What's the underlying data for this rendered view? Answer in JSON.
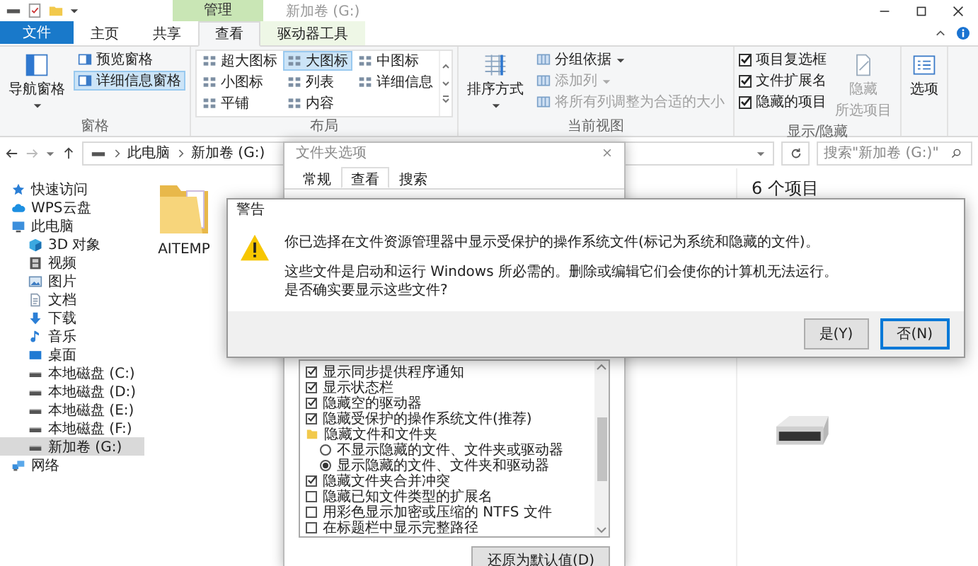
{
  "title_bar": {
    "context_tab": "管理",
    "title": "新加卷 (G:)"
  },
  "ribbon_tabs": [
    {
      "label": "文件",
      "kind": "file",
      "selected": false
    },
    {
      "label": "主页",
      "kind": "tab",
      "selected": false
    },
    {
      "label": "共享",
      "kind": "tab",
      "selected": false
    },
    {
      "label": "查看",
      "kind": "tab",
      "selected": true
    },
    {
      "label": "驱动器工具",
      "kind": "context",
      "selected": false
    }
  ],
  "ribbon": {
    "panes": {
      "label": "窗格",
      "nav_pane": "导航窗格",
      "items": [
        {
          "label": "预览窗格",
          "selected": false
        },
        {
          "label": "详细信息窗格",
          "selected": true
        }
      ]
    },
    "layout": {
      "label": "布局",
      "items": [
        {
          "label": "超大图标",
          "selected": false
        },
        {
          "label": "小图标",
          "selected": false
        },
        {
          "label": "平铺",
          "selected": false
        },
        {
          "label": "大图标",
          "selected": true
        },
        {
          "label": "列表",
          "selected": false
        },
        {
          "label": "内容",
          "selected": false
        },
        {
          "label": "中图标",
          "selected": false
        },
        {
          "label": "详细信息",
          "selected": false
        }
      ]
    },
    "current_view": {
      "label": "当前视图",
      "sort": "排序方式",
      "items": [
        {
          "label": "分组依据",
          "disabled": false,
          "dropdown": true
        },
        {
          "label": "添加列",
          "disabled": true,
          "dropdown": true
        },
        {
          "label": "将所有列调整为合适的大小",
          "disabled": true,
          "dropdown": false
        }
      ]
    },
    "show_hide": {
      "label": "显示/隐藏",
      "checkboxes": [
        {
          "label": "项目复选框",
          "checked": true
        },
        {
          "label": "文件扩展名",
          "checked": true
        },
        {
          "label": "隐藏的项目",
          "checked": true
        }
      ],
      "hide_selected": {
        "lines": [
          "隐藏",
          "所选项目"
        ],
        "disabled": true
      }
    },
    "options": {
      "label": "选项"
    }
  },
  "address_bar": {
    "path": [
      "此电脑",
      "新加卷 (G:)"
    ],
    "search_placeholder": "搜索\"新加卷 (G:)\""
  },
  "sidebar": {
    "items": [
      {
        "label": "快速访问",
        "kind": "star",
        "selected": false
      },
      {
        "label": "WPS云盘",
        "kind": "cloud",
        "selected": false
      },
      {
        "label": "此电脑",
        "kind": "pc",
        "selected": false,
        "children": [
          {
            "label": "3D 对象",
            "kind": "cube",
            "selected": false
          },
          {
            "label": "视频",
            "kind": "video",
            "selected": false
          },
          {
            "label": "图片",
            "kind": "picture",
            "selected": false
          },
          {
            "label": "文档",
            "kind": "doc",
            "selected": false
          },
          {
            "label": "下载",
            "kind": "download",
            "selected": false
          },
          {
            "label": "音乐",
            "kind": "music",
            "selected": false
          },
          {
            "label": "桌面",
            "kind": "desktop",
            "selected": false
          },
          {
            "label": "本地磁盘 (C:)",
            "kind": "drive",
            "selected": false
          },
          {
            "label": "本地磁盘 (D:)",
            "kind": "drive",
            "selected": false
          },
          {
            "label": "本地磁盘 (E:)",
            "kind": "drive",
            "selected": false
          },
          {
            "label": "本地磁盘 (F:)",
            "kind": "drive",
            "selected": false
          },
          {
            "label": "新加卷 (G:)",
            "kind": "drive",
            "selected": true
          }
        ]
      },
      {
        "label": "网络",
        "kind": "network",
        "selected": false
      }
    ]
  },
  "files": [
    {
      "name": "AITEMP"
    }
  ],
  "details_pane": {
    "count": "6 个项目"
  },
  "folder_options": {
    "title": "文件夹选项",
    "tabs": [
      {
        "label": "常规",
        "selected": false
      },
      {
        "label": "查看",
        "selected": true
      },
      {
        "label": "搜索",
        "selected": false
      }
    ],
    "settings": [
      {
        "kind": "checkbox",
        "label": "显示同步提供程序通知",
        "checked": true
      },
      {
        "kind": "checkbox",
        "label": "显示状态栏",
        "checked": true
      },
      {
        "kind": "checkbox",
        "label": "隐藏空的驱动器",
        "checked": true
      },
      {
        "kind": "checkbox",
        "label": "隐藏受保护的操作系统文件(推荐)",
        "checked": true
      },
      {
        "kind": "folder",
        "label": "隐藏文件和文件夹"
      },
      {
        "kind": "radio",
        "label": "不显示隐藏的文件、文件夹或驱动器",
        "selected": false
      },
      {
        "kind": "radio",
        "label": "显示隐藏的文件、文件夹和驱动器",
        "selected": true
      },
      {
        "kind": "checkbox",
        "label": "隐藏文件夹合并冲突",
        "checked": true
      },
      {
        "kind": "checkbox",
        "label": "隐藏已知文件类型的扩展名",
        "checked": false
      },
      {
        "kind": "checkbox",
        "label": "用彩色显示加密或压缩的 NTFS 文件",
        "checked": false
      },
      {
        "kind": "checkbox",
        "label": "在标题栏中显示完整路径",
        "checked": false
      }
    ],
    "restore_button": "还原为默认值(D)"
  },
  "warning": {
    "title": "警告",
    "message": "你已选择在文件资源管理器中显示受保护的操作系统文件(标记为系统和隐藏的文件)。",
    "detail_lines": [
      "这些文件是启动和运行 Windows 所必需的。删除或编辑它们会使你的计算机无法运行。",
      "是否确实要显示这些文件?"
    ],
    "buttons": [
      {
        "label": "是(Y)",
        "selected": false
      },
      {
        "label": "否(N)",
        "selected": true
      }
    ]
  }
}
